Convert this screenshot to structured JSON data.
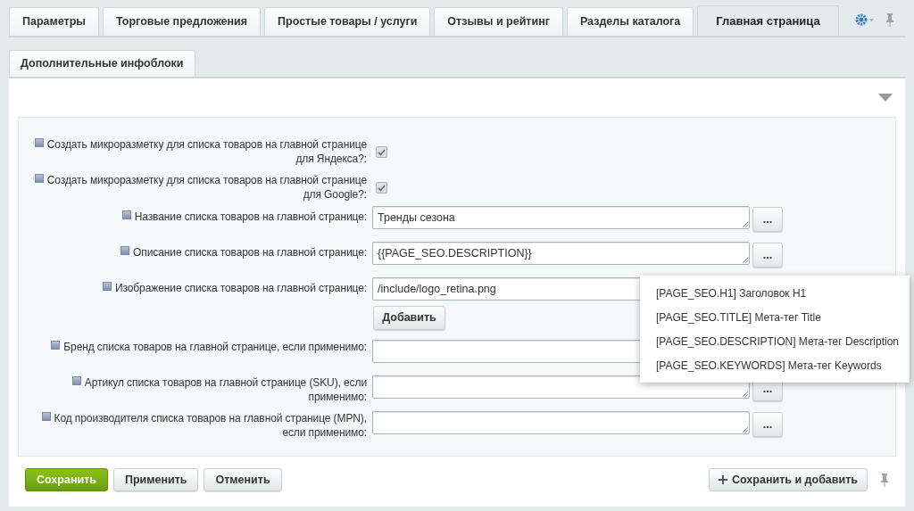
{
  "tabs": [
    {
      "label": "Параметры",
      "selected": false
    },
    {
      "label": "Торговые предложения",
      "selected": false
    },
    {
      "label": "Простые товары / услуги",
      "selected": false
    },
    {
      "label": "Отзывы и рейтинг",
      "selected": false
    },
    {
      "label": "Разделы каталога",
      "selected": false
    },
    {
      "label": "Главная страница",
      "selected": true
    }
  ],
  "subtabs": [
    {
      "label": "Дополнительные инфоблоки",
      "selected": true
    }
  ],
  "fields": [
    {
      "kind": "checkbox",
      "label": "Создать микроразметку для списка товаров на главной странице для Яндекса?:",
      "checked": true
    },
    {
      "kind": "checkbox",
      "label": "Создать микроразметку для списка товаров на главной странице для Google?:",
      "checked": true
    },
    {
      "kind": "textarea",
      "label": "Название списка товаров на главной странице:",
      "value": "Тренды сезона",
      "button": "..."
    },
    {
      "kind": "textarea",
      "label": "Описание списка товаров на главной странице:",
      "value": "{{PAGE_SEO.DESCRIPTION}}",
      "button": "..."
    },
    {
      "kind": "file",
      "label": "Изображение списка товаров на главной странице:",
      "value": "/include/logo_retina.png",
      "add_button": "Добавить"
    },
    {
      "kind": "textarea",
      "label": "Бренд списка товаров на главной странице, если применимо:"
    },
    {
      "kind": "textarea",
      "label": "Артикул списка товаров на главной странице (SKU), если применимо:",
      "button": "..."
    },
    {
      "kind": "textarea",
      "label": "Код производителя списка товаров на главной странице (MPN), если применимо:",
      "button": "..."
    }
  ],
  "popup_menu": [
    "[PAGE_SEO.H1] Заголовок H1",
    "[PAGE_SEO.TITLE] Мета-тег Title",
    "[PAGE_SEO.DESCRIPTION] Мета-тег Description",
    "[PAGE_SEO.KEYWORDS] Мета-тег Keywords"
  ],
  "footer": {
    "save": "Сохранить",
    "apply": "Применить",
    "cancel": "Отменить",
    "save_add": "Сохранить и добавить"
  }
}
